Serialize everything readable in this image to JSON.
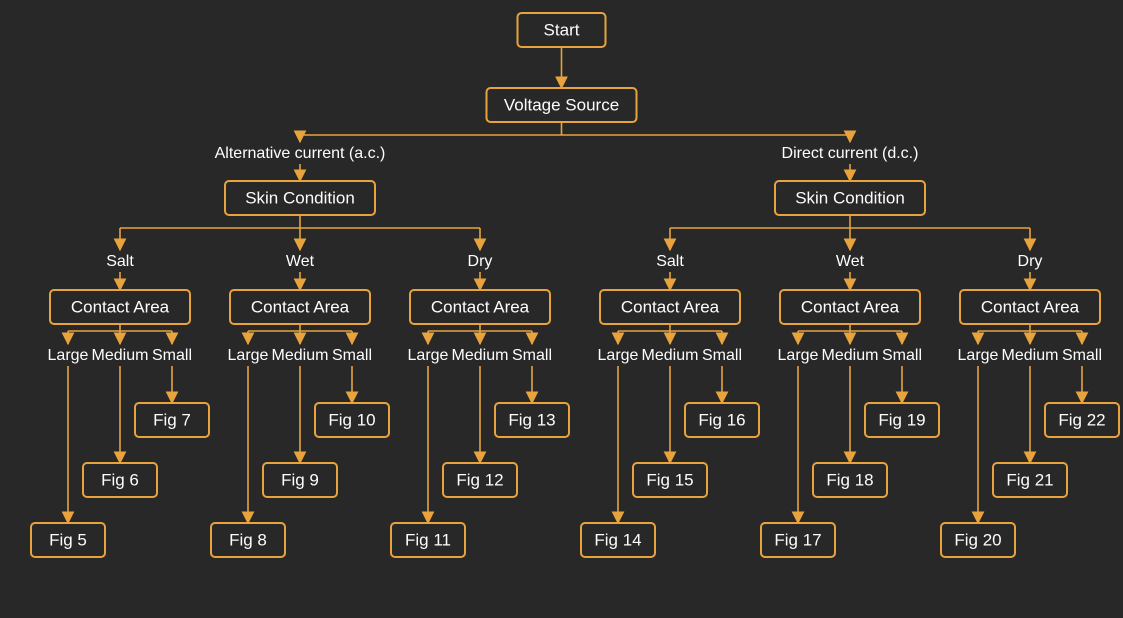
{
  "diagram": {
    "title": "Start",
    "root_label": "Voltage Source",
    "branches": {
      "ac": {
        "label": "Alternative current (a.c.)",
        "node": "Skin Condition",
        "conditions": [
          "Salt",
          "Wet",
          "Dry"
        ],
        "contact_label": "Contact Area",
        "size_labels": [
          "Large",
          "Medium",
          "Small"
        ],
        "figs": {
          "salt": [
            "Fig 5",
            "Fig 6",
            "Fig 7"
          ],
          "wet": [
            "Fig 8",
            "Fig 9",
            "Fig 10"
          ],
          "dry": [
            "Fig 11",
            "Fig 12",
            "Fig 13"
          ]
        }
      },
      "dc": {
        "label": "Direct current (d.c.)",
        "node": "Skin Condition",
        "conditions": [
          "Salt",
          "Wet",
          "Dry"
        ],
        "contact_label": "Contact Area",
        "size_labels": [
          "Large",
          "Medium",
          "Small"
        ],
        "figs": {
          "salt": [
            "Fig 14",
            "Fig 15",
            "Fig 16"
          ],
          "wet": [
            "Fig 17",
            "Fig 18",
            "Fig 19"
          ],
          "dry": [
            "Fig 20",
            "Fig 21",
            "Fig 22"
          ]
        }
      }
    }
  }
}
